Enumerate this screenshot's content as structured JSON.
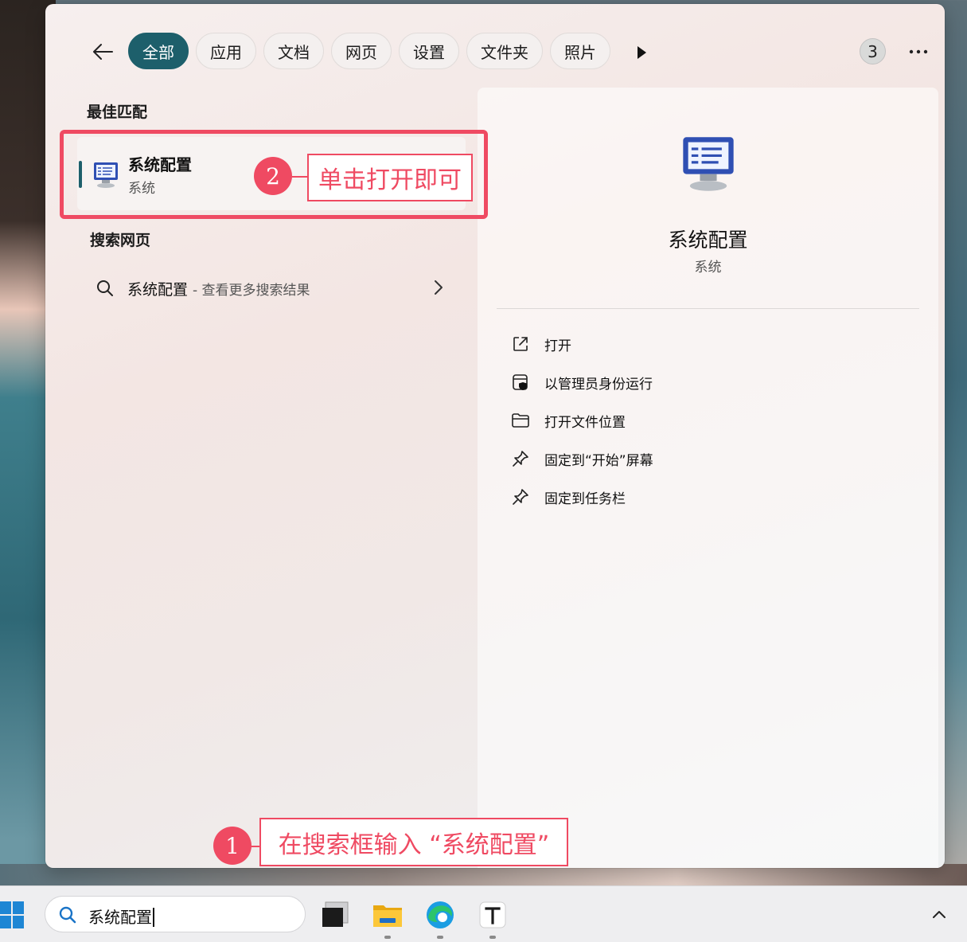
{
  "filters": {
    "tabs": [
      "全部",
      "应用",
      "文档",
      "网页",
      "设置",
      "文件夹",
      "照片"
    ],
    "active_index": 0,
    "result_count": "3"
  },
  "best_match": {
    "section_title": "最佳匹配",
    "name": "系统配置",
    "type": "系统"
  },
  "web_search": {
    "section_title": "搜索网页",
    "query": "系统配置",
    "hint": "- 查看更多搜索结果"
  },
  "preview": {
    "title": "系统配置",
    "subtitle": "系统",
    "actions": [
      {
        "label": "打开",
        "icon": "open-external-icon"
      },
      {
        "label": "以管理员身份运行",
        "icon": "shield-admin-icon"
      },
      {
        "label": "打开文件位置",
        "icon": "folder-icon"
      },
      {
        "label": "固定到“开始”屏幕",
        "icon": "pin-icon"
      },
      {
        "label": "固定到任务栏",
        "icon": "pin-icon"
      }
    ]
  },
  "annotations": {
    "step1_number": "1",
    "step1_text": "在搜索框输入 “系统配置”",
    "step2_number": "2",
    "step2_text": "单击打开即可",
    "color": "#ef4a62"
  },
  "taskbar": {
    "search_value": "系统配置",
    "apps": [
      "task-view-icon",
      "file-explorer-icon",
      "edge-icon",
      "text-app-icon"
    ]
  },
  "colors": {
    "accent": "#1d5f6b"
  }
}
